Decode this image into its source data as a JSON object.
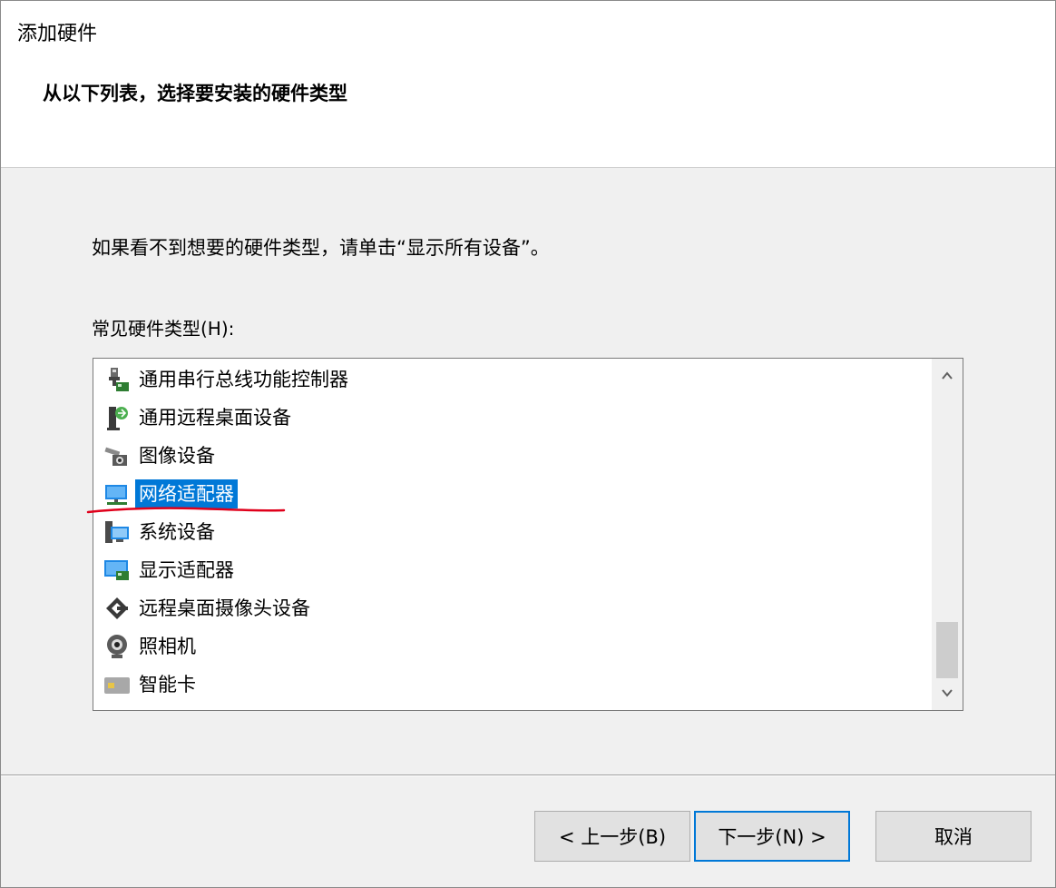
{
  "window": {
    "title": "添加硬件"
  },
  "header": {
    "heading": "从以下列表，选择要安装的硬件类型"
  },
  "body": {
    "instruction": "如果看不到想要的硬件类型，请单击“显示所有设备”。",
    "list_label": "常见硬件类型(H):"
  },
  "hardware_list": {
    "items": [
      {
        "label": "通用串行总线功能控制器",
        "icon": "usb-controller-icon"
      },
      {
        "label": "通用远程桌面设备",
        "icon": "remote-desktop-device-icon"
      },
      {
        "label": "图像设备",
        "icon": "imaging-device-icon"
      },
      {
        "label": "网络适配器",
        "icon": "network-adapter-icon",
        "selected": true
      },
      {
        "label": "系统设备",
        "icon": "system-device-icon"
      },
      {
        "label": "显示适配器",
        "icon": "display-adapter-icon"
      },
      {
        "label": "远程桌面摄像头设备",
        "icon": "remote-camera-icon"
      },
      {
        "label": "照相机",
        "icon": "camera-icon"
      },
      {
        "label": "智能卡",
        "icon": "smart-card-icon"
      }
    ]
  },
  "buttons": {
    "back": "< 上一步(B)",
    "next": "下一步(N) >",
    "cancel": "取消"
  },
  "colors": {
    "selection": "#0078d7",
    "annotation": "#e0001b",
    "default_button_border": "#0078d7"
  }
}
